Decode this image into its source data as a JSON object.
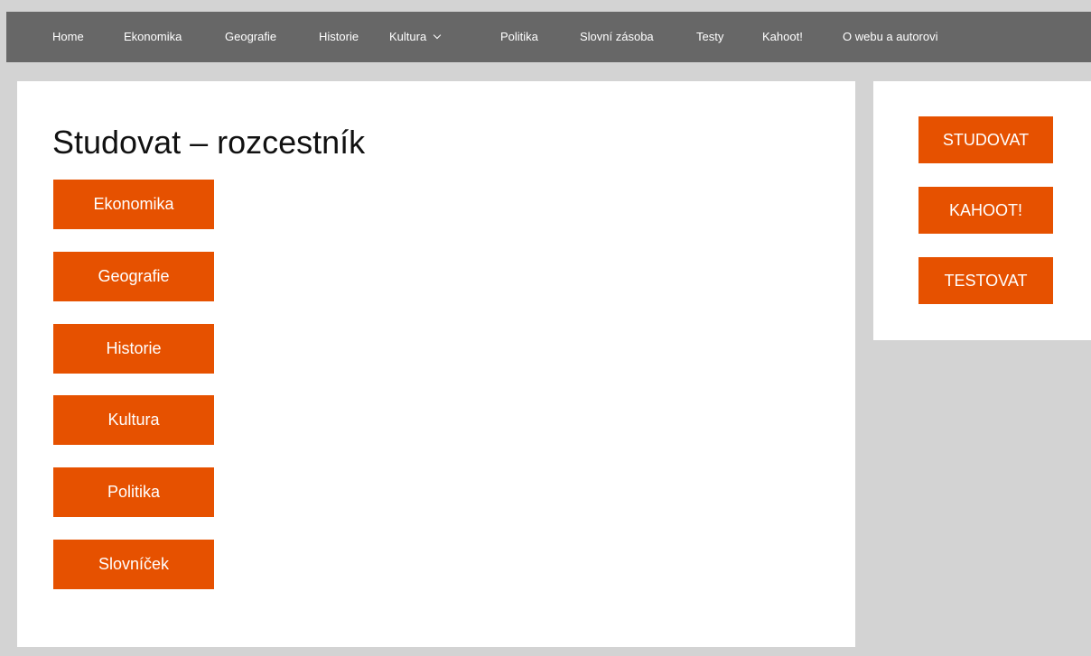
{
  "nav": {
    "items": [
      {
        "label": "Home"
      },
      {
        "label": "Ekonomika"
      },
      {
        "label": "Geografie"
      },
      {
        "label": "Historie"
      },
      {
        "label": "Kultura",
        "has_dropdown": true
      },
      {
        "label": "Politika"
      },
      {
        "label": "Slovní zásoba"
      },
      {
        "label": "Testy"
      },
      {
        "label": "Kahoot!"
      },
      {
        "label": "O webu a autorovi"
      }
    ]
  },
  "main": {
    "title": "Studovat – rozcestník",
    "buttons": [
      {
        "label": "Ekonomika"
      },
      {
        "label": "Geografie"
      },
      {
        "label": "Historie"
      },
      {
        "label": "Kultura"
      },
      {
        "label": "Politika"
      },
      {
        "label": "Slovníček"
      }
    ]
  },
  "sidebar": {
    "buttons": [
      {
        "label": "STUDOVAT"
      },
      {
        "label": "KAHOOT!"
      },
      {
        "label": "TESTOVAT"
      }
    ]
  },
  "colors": {
    "accent": "#e65100",
    "nav_background": "#676767",
    "page_background": "#d3d3d3"
  },
  "icons": {
    "dropdown": "chevron-down-icon"
  }
}
